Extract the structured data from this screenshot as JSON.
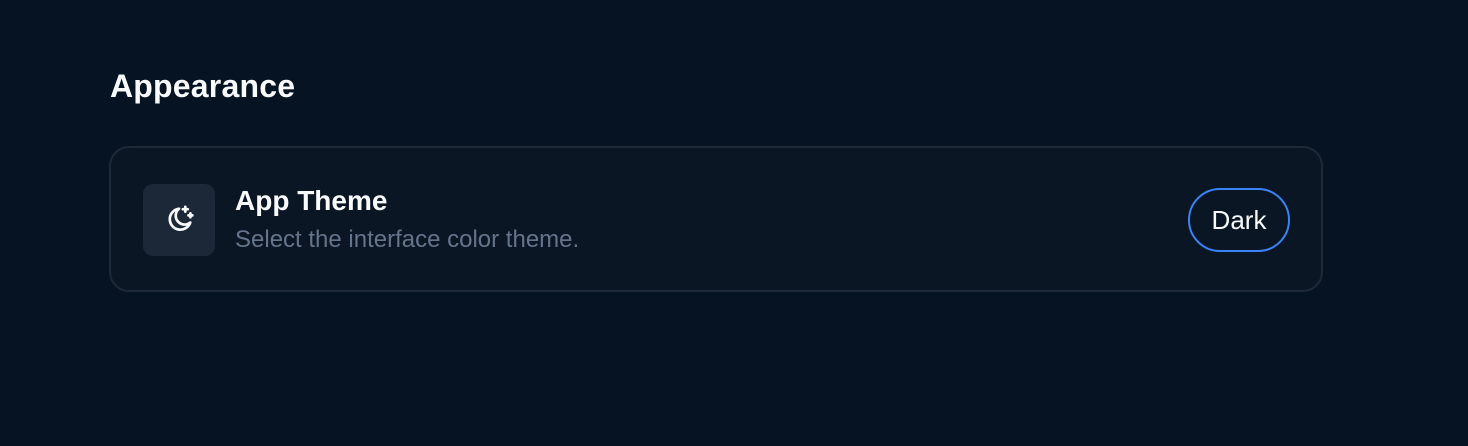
{
  "section": {
    "title": "Appearance"
  },
  "setting": {
    "icon": "moon-stars-icon",
    "title": "App Theme",
    "description": "Select the interface color theme.",
    "value": "Dark"
  },
  "colors": {
    "background": "#051322",
    "card_background": "#0b1625",
    "card_border": "#1e2937",
    "icon_tile": "#1c2738",
    "accent": "#3b82f6",
    "muted_text": "#64748b",
    "primary_text": "#f8fafc"
  }
}
